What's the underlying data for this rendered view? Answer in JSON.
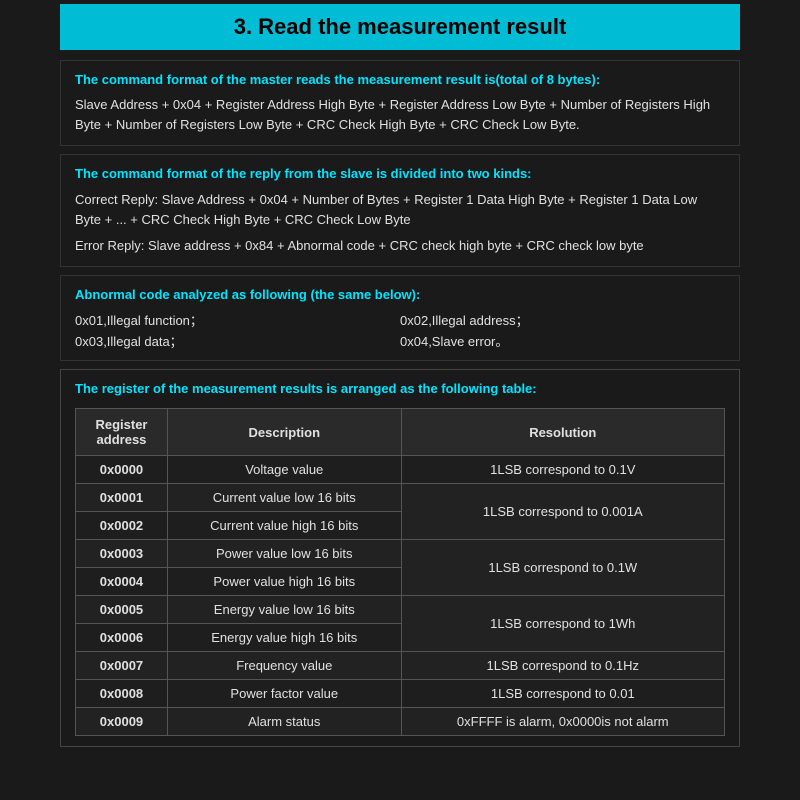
{
  "title": "3. Read the measurement result",
  "section1": {
    "heading": "The command format of the master reads the measurement result is(total of 8 bytes):",
    "body": "Slave Address + 0x04 + Register Address High Byte + Register Address Low Byte + Number of Registers High Byte + Number of Registers Low Byte + CRC Check High Byte + CRC Check Low Byte."
  },
  "section2": {
    "heading": "The command format of the reply from the slave is divided into two kinds:",
    "correct": "Correct Reply: Slave Address + 0x04 + Number of Bytes + Register 1 Data High Byte + Register 1 Data Low Byte + ... + CRC Check High Byte + CRC Check Low Byte",
    "error": "Error Reply: Slave address + 0x84 + Abnormal code + CRC check high byte + CRC check low byte"
  },
  "section3": {
    "heading": "Abnormal code analyzed as following (the same below):",
    "codes": [
      "0x01,Illegal function；",
      "0x02,Illegal address；",
      "0x03,Illegal data；",
      "0x04,Slave error。"
    ]
  },
  "table": {
    "intro": "The register of the measurement results is arranged as the following table:",
    "headers": [
      "Register address",
      "Description",
      "Resolution"
    ],
    "rows": [
      {
        "addr": "0x0000",
        "desc": "Voltage value",
        "res": "1LSB correspond to 0.1V",
        "rowspan": 1
      },
      {
        "addr": "0x0001",
        "desc": "Current value low 16 bits",
        "res": "1LSB correspond to 0.001A",
        "rowspan": 2
      },
      {
        "addr": "0x0002",
        "desc": "Current value high 16 bits",
        "res": "",
        "rowspan": 0
      },
      {
        "addr": "0x0003",
        "desc": "Power value low 16 bits",
        "res": "1LSB correspond to 0.1W",
        "rowspan": 2
      },
      {
        "addr": "0x0004",
        "desc": "Power value high 16 bits",
        "res": "",
        "rowspan": 0
      },
      {
        "addr": "0x0005",
        "desc": "Energy value low 16 bits",
        "res": "1LSB correspond to 1Wh",
        "rowspan": 2
      },
      {
        "addr": "0x0006",
        "desc": "Energy value high 16 bits",
        "res": "",
        "rowspan": 0
      },
      {
        "addr": "0x0007",
        "desc": "Frequency value",
        "res": "1LSB correspond to 0.1Hz",
        "rowspan": 1
      },
      {
        "addr": "0x0008",
        "desc": "Power factor value",
        "res": "1LSB correspond to 0.01",
        "rowspan": 1
      },
      {
        "addr": "0x0009",
        "desc": "Alarm status",
        "res": "0xFFFF is alarm, 0x0000is not alarm",
        "rowspan": 1
      }
    ]
  }
}
